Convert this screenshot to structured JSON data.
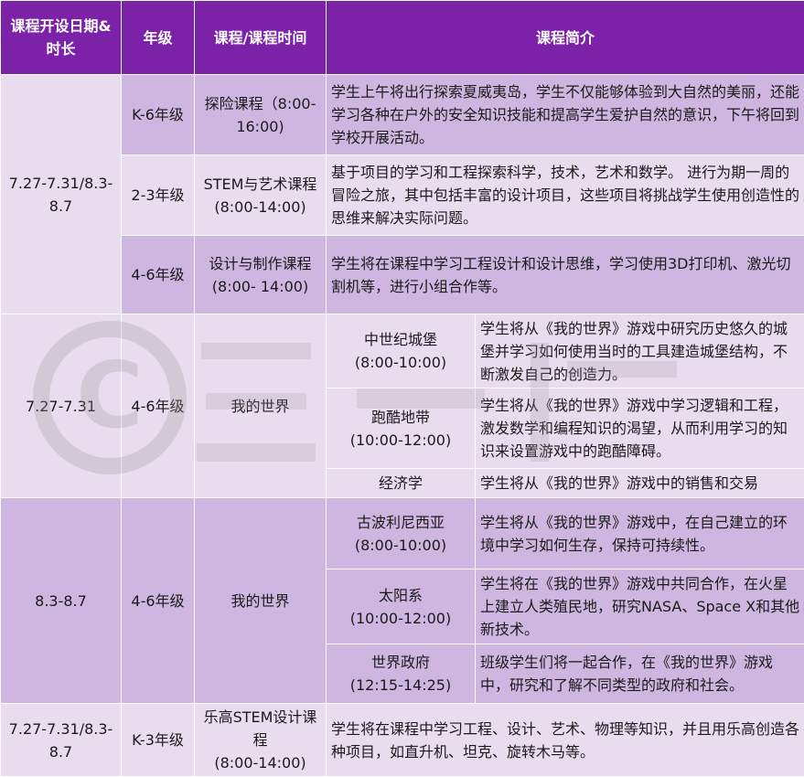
{
  "header": {
    "date_duration": "课程开设日期&时长",
    "grade": "年级",
    "course_time": "课程/课程时间",
    "description": "课程简介"
  },
  "section1": {
    "dates": "7.27-7.31/8.3-8.7",
    "rows": [
      {
        "grade": "K-6年级",
        "course": "探险课程（8:00-16:00)",
        "desc": "学生上午将出行探索夏威夷岛，学生不仅能够体验到大自然的美丽，还能学习各种在户外的安全知识技能和提高学生爱护自然的意识，下午将回到学校开展活动。"
      },
      {
        "grade": "2-3年级",
        "course": "STEM与艺术课程(8:00-14:00)",
        "desc": "基于项目的学习和工程探索科学，技术，艺术和数学。 进行为期一周的冒险之旅，其中包括丰富的设计项目，这些项目将挑战学生使用创造性的思维来解决实际问题。"
      },
      {
        "grade": "4-6年级",
        "course": "设计与制作课程(8:00- 14:00)",
        "desc": "学生将在课程中学习工程设计和设计思维，学习使用3D打印机、激光切割机等，进行小组合作等。"
      }
    ]
  },
  "section2": {
    "dates": "7.27-7.31",
    "grade": "4-6年级",
    "course": "我的世界",
    "rows": [
      {
        "name": "中世纪城堡",
        "time": "(8:00-10:00)",
        "desc": "学生将从《我的世界》游戏中研究历史悠久的城堡并学习如何使用当时的工具建造城堡结构，不断激发自己的创造力。"
      },
      {
        "name": "跑酷地带",
        "time": "(10:00-12:00)",
        "desc": "学生将从《我的世界》游戏中学习逻辑和工程，激发数学和编程知识的渴望，从而利用学习的知识来设置游戏中的跑酷障碍。"
      },
      {
        "name": "经济学",
        "time": "",
        "desc": "学生将从《我的世界》游戏中的销售和交易"
      }
    ]
  },
  "section3": {
    "dates": "8.3-8.7",
    "grade": "4-6年级",
    "course": "我的世界",
    "rows": [
      {
        "name": "古波利尼西亚",
        "time": "(8:00-10:00)",
        "desc": "学生将从《我的世界》游戏中，在自己建立的环境中学习如何生存，保持可持续性。"
      },
      {
        "name": "太阳系",
        "time": "(10:00-12:00)",
        "desc": "学生将在《我的世界》游戏中共同合作，在火星上建立人类殖民地，研究NASA、Space X和其他新技术。"
      },
      {
        "name": "世界政府",
        "time": "(12:15-14:25)",
        "desc": "班级学生们将一起合作，在《我的世界》游戏中，研究和了解不同类型的政府和社会。"
      }
    ]
  },
  "section4": {
    "dates": "7.27-7.31/8.3-8.7",
    "grade": "K-3年级",
    "course": "乐高STEM设计课程",
    "time": "(8:00-14:00)",
    "desc": "学生将在课程中学习工程、设计、艺术、物理等知识，并且用乐高创造各种项目，如直升机、坦克、旋转木马等。"
  },
  "colors": {
    "header": "#7b22a9",
    "dark_cell": "#cfb6e0",
    "light_cell": "#e8dcef"
  }
}
